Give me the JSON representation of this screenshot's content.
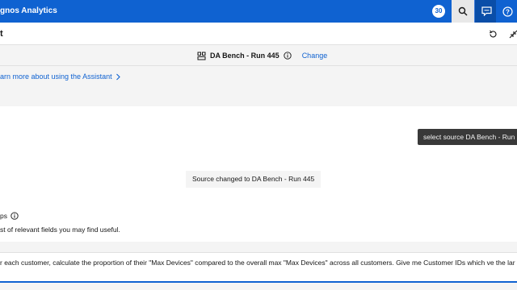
{
  "header": {
    "app_title": "gnos Analytics",
    "notification_count": "30",
    "icons": [
      "search-icon",
      "chat-icon",
      "help-icon"
    ]
  },
  "subheader": {
    "title": "t",
    "icons": [
      "refresh-icon",
      "collapse-icon"
    ]
  },
  "source_bar": {
    "source_name": "DA Bench - Run 445",
    "change_label": "Change"
  },
  "learn": {
    "link_text": "arn more about using the Assistant"
  },
  "tooltip": {
    "text": "select source DA Bench - Run"
  },
  "messages": {
    "source_changed": "Source changed to DA Bench - Run 445"
  },
  "suggestions": {
    "title": "ps",
    "description": "st of relevant fields you may find useful."
  },
  "input": {
    "value": "r each customer, calculate the proportion of their \"Max Devices\" compared to the overall max \"Max Devices\" across all customers. Give me Customer IDs which ve the lar"
  },
  "colors": {
    "brand": "#0f62d1",
    "tooltip_bg": "#393939",
    "panel_bg": "#f4f4f4"
  }
}
